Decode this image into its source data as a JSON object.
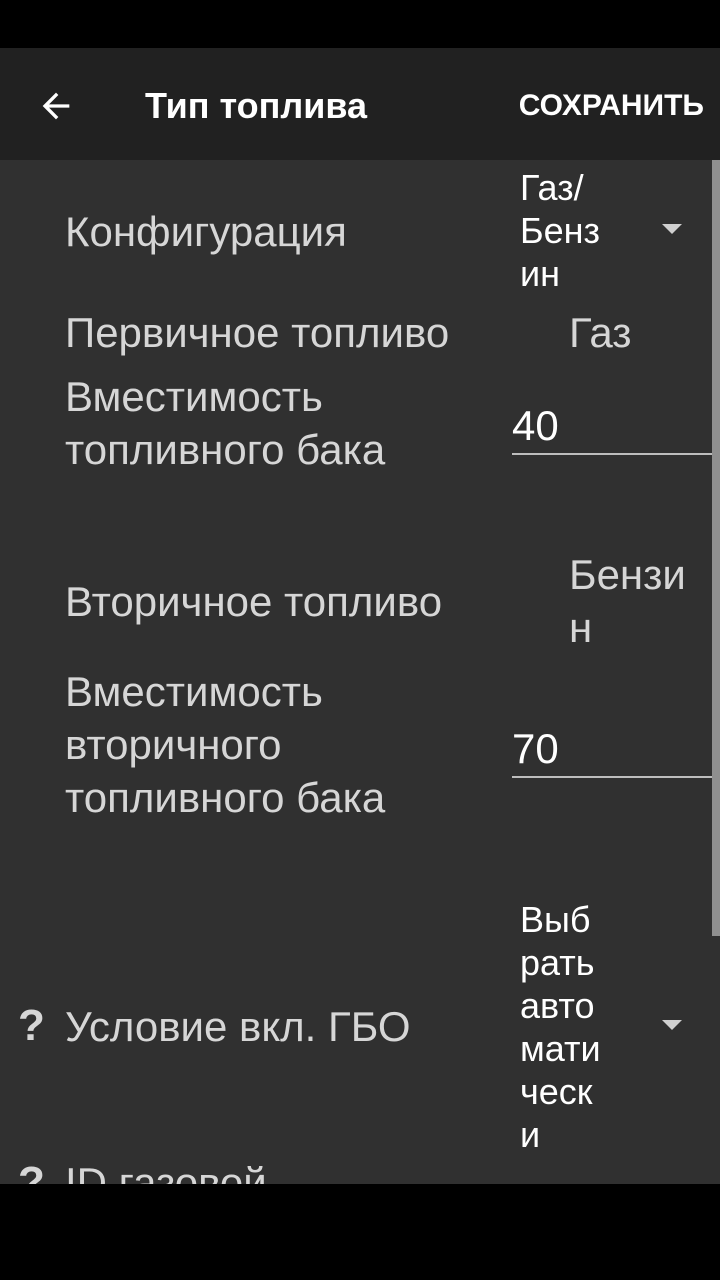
{
  "app_bar": {
    "title": "Тип топлива",
    "save_label": "СОХРАНИТЬ"
  },
  "fields": {
    "configuration": {
      "label": "Конфигурация",
      "value_lines": [
        "Газ/",
        "Бенз",
        "ин"
      ]
    },
    "primary_fuel": {
      "label": "Первичное топливо",
      "value": "Газ"
    },
    "primary_tank": {
      "label_lines": [
        "Вместимость",
        "топливного бака"
      ],
      "value": "40"
    },
    "secondary_fuel": {
      "label": "Вторичное топливо",
      "value_lines": [
        "Бензи",
        "н"
      ]
    },
    "secondary_tank": {
      "label_lines": [
        "Вместимость",
        "вторичного",
        "топливного бака"
      ],
      "value": "70"
    },
    "lpg_condition": {
      "label": "Условие вкл. ГБО",
      "value_lines": [
        "Выб",
        "рать",
        "авто",
        "мати",
        "ческ",
        "и"
      ]
    },
    "next_item": {
      "label": "ID газовой"
    }
  },
  "icons": {
    "back": "arrow-back-icon",
    "dropdown": "chevron-down-icon",
    "help": "help-icon"
  },
  "colors": {
    "app_bar": "#212121",
    "background": "#303030",
    "text": "#d6d6d6"
  }
}
